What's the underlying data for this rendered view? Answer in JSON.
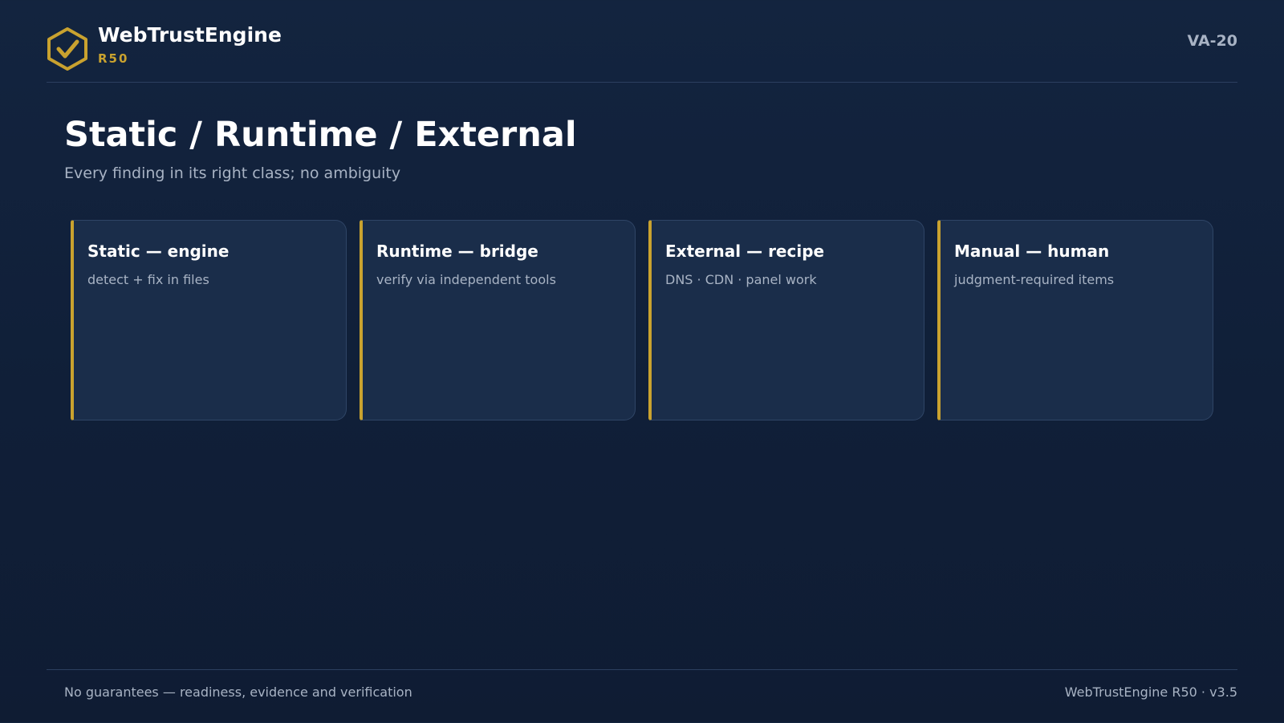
{
  "header": {
    "brand_name": "WebTrustEngine",
    "brand_sub": "R50",
    "slide_id": "VA-20",
    "logo_icon": "hexagon-check-icon"
  },
  "main": {
    "title": "Static / Runtime / External",
    "subtitle": "Every finding in its right class; no ambiguity",
    "cards": [
      {
        "title": "Static — engine",
        "desc": "detect + fix in files"
      },
      {
        "title": "Runtime — bridge",
        "desc": "verify via independent tools"
      },
      {
        "title": "External — recipe",
        "desc": "DNS · CDN · panel work"
      },
      {
        "title": "Manual — human",
        "desc": "judgment-required items"
      }
    ]
  },
  "footer": {
    "left": "No guarantees — readiness, evidence and verification",
    "right": "WebTrustEngine R50 · v3.5"
  },
  "colors": {
    "background": "#12223c",
    "card": "#1a2d4a",
    "accent": "#c9a22f",
    "muted_text": "#a8b3c4"
  }
}
